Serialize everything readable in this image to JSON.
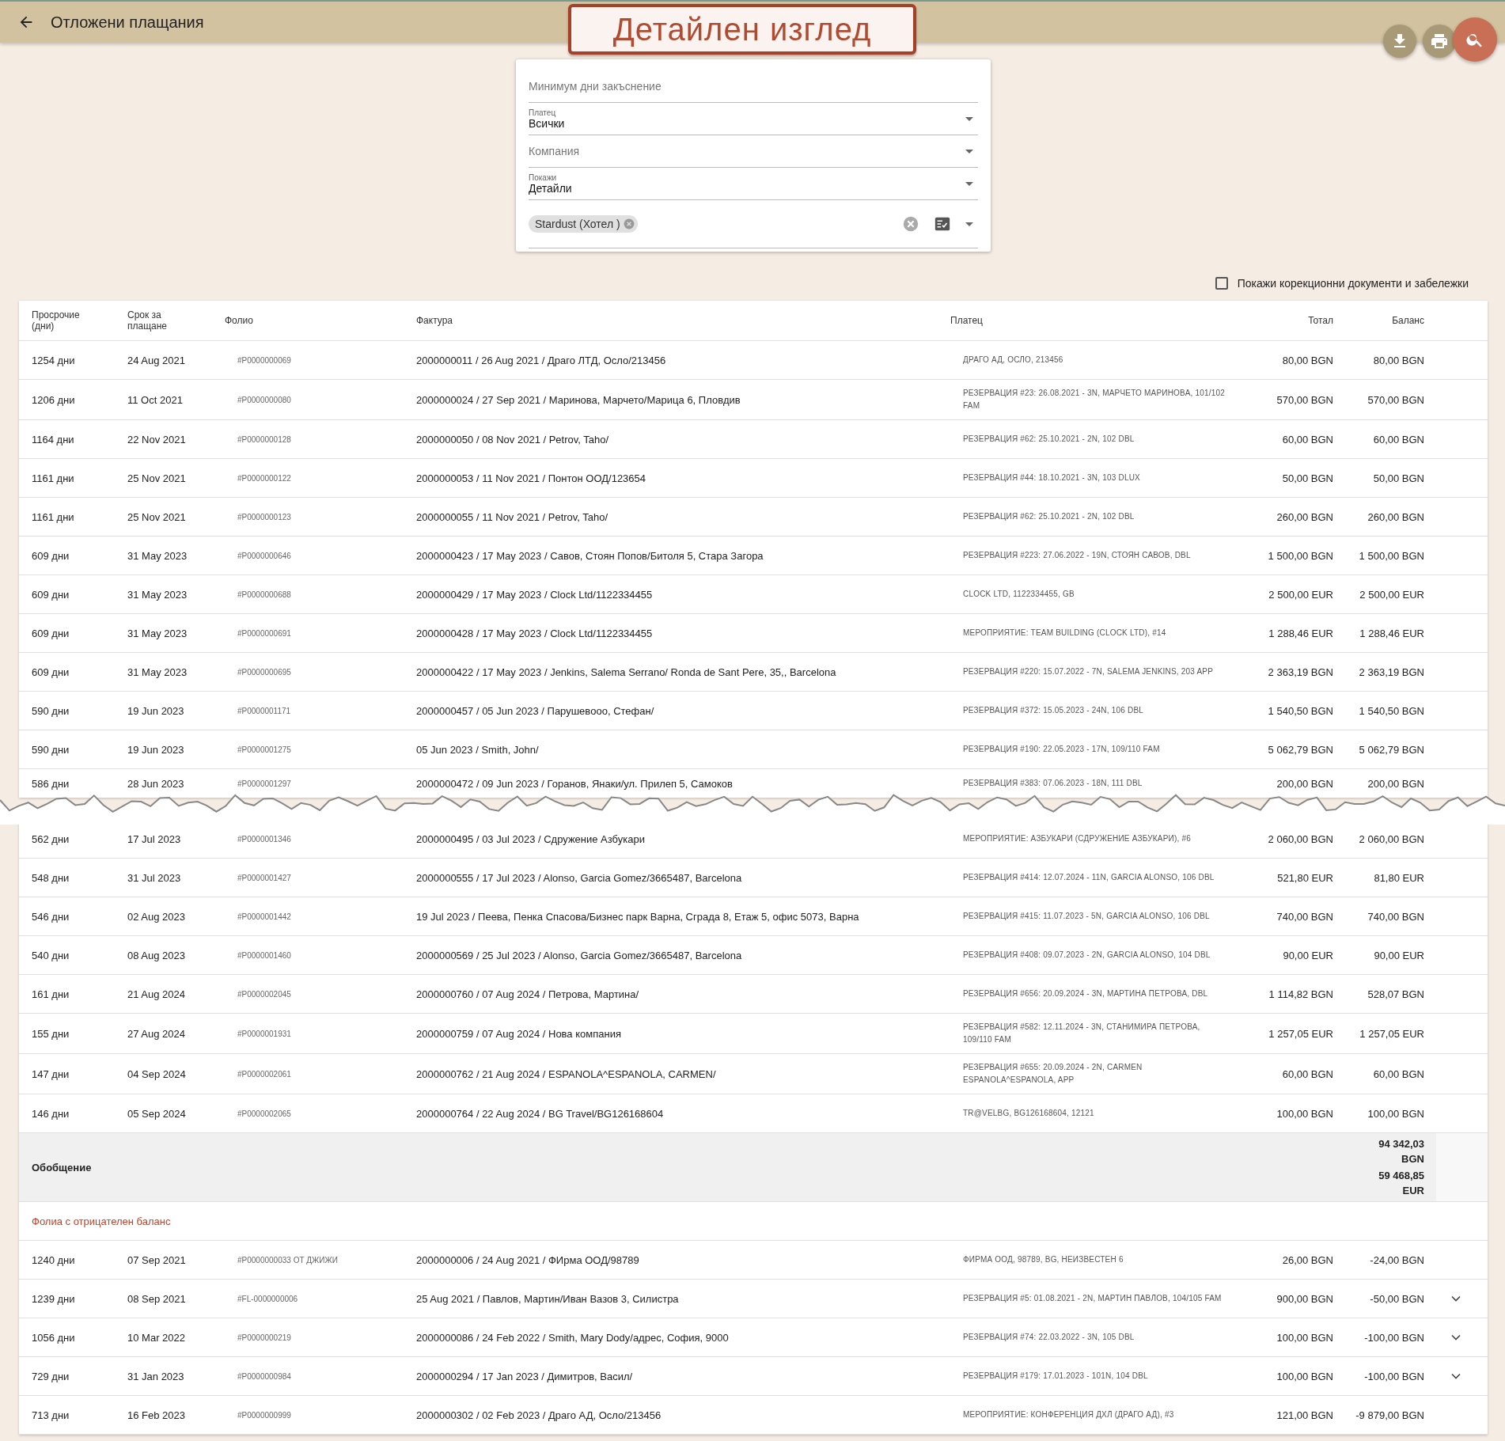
{
  "header": {
    "title": "Отложени плащания"
  },
  "banner": {
    "text": "Детайлен изглед"
  },
  "filters": {
    "min_days": {
      "placeholder": "Минимум дни закъснение"
    },
    "payer": {
      "label": "Платец",
      "value": "Всички"
    },
    "company": {
      "placeholder": "Компания"
    },
    "show": {
      "label": "Покажи",
      "value": "Детайли"
    },
    "chips": [
      "Stardust (Хотел )"
    ]
  },
  "corrections": {
    "label": "Покажи корекционни документи и забележки",
    "checked": false
  },
  "table": {
    "columns": [
      "Просрочие (дни)",
      "Срок за плащане",
      "Фолио",
      "Фактура",
      "Платец",
      "Тотал",
      "Баланс"
    ],
    "rows_top": [
      {
        "overdue": "1254 дни",
        "due": "24 Aug 2021",
        "folio": "#P0000000069",
        "invoice": "2000000011 / 26 Aug 2021 / Драго ЛТД, Осло/213456",
        "payer": "ДРАГО АД, ОСЛО, 213456",
        "total": "80,00 BGN",
        "balance": "80,00 BGN"
      },
      {
        "overdue": "1206 дни",
        "due": "11 Oct 2021",
        "folio": "#P0000000080",
        "invoice": "2000000024 / 27 Sep 2021 / Маринова, Марчето/Марица 6, Пловдив",
        "payer": "РЕЗЕРВАЦИЯ #23: 26.08.2021 - 3N, МАРЧЕТО МАРИНОВА, 101/102 FAM",
        "total": "570,00 BGN",
        "balance": "570,00 BGN"
      },
      {
        "overdue": "1164 дни",
        "due": "22 Nov 2021",
        "folio": "#P0000000128",
        "invoice": "2000000050 / 08 Nov 2021 / Petrov, Taho/",
        "payer": "РЕЗЕРВАЦИЯ #62: 25.10.2021 - 2N, 102 DBL",
        "total": "60,00 BGN",
        "balance": "60,00 BGN"
      },
      {
        "overdue": "1161 дни",
        "due": "25 Nov 2021",
        "folio": "#P0000000122",
        "invoice": "2000000053 / 11 Nov 2021 / Понтон ООД/123654",
        "payer": "РЕЗЕРВАЦИЯ #44: 18.10.2021 - 3N, 103 DLUX",
        "total": "50,00 BGN",
        "balance": "50,00 BGN"
      },
      {
        "overdue": "1161 дни",
        "due": "25 Nov 2021",
        "folio": "#P0000000123",
        "invoice": "2000000055 / 11 Nov 2021 / Petrov, Taho/",
        "payer": "РЕЗЕРВАЦИЯ #62: 25.10.2021 - 2N, 102 DBL",
        "total": "260,00 BGN",
        "balance": "260,00 BGN"
      },
      {
        "overdue": "609 дни",
        "due": "31 May 2023",
        "folio": "#P0000000646",
        "invoice": "2000000423 / 17 May 2023 / Савов, Стоян Попов/Битоля 5, Стара Загора",
        "payer": "РЕЗЕРВАЦИЯ #223: 27.06.2022 - 19N, СТОЯН САВОВ, DBL",
        "total": "1 500,00 BGN",
        "balance": "1 500,00 BGN"
      },
      {
        "overdue": "609 дни",
        "due": "31 May 2023",
        "folio": "#P0000000688",
        "invoice": "2000000429 / 17 May 2023 / Clock Ltd/1122334455",
        "payer": "CLOCK LTD, 1122334455, GB",
        "total": "2 500,00 EUR",
        "balance": "2 500,00 EUR"
      },
      {
        "overdue": "609 дни",
        "due": "31 May 2023",
        "folio": "#P0000000691",
        "invoice": "2000000428 / 17 May 2023 / Clock Ltd/1122334455",
        "payer": "МЕРОПРИЯТИЕ: TEAM BUILDING (CLOCK LTD), #14",
        "total": "1 288,46 EUR",
        "balance": "1 288,46 EUR"
      },
      {
        "overdue": "609 дни",
        "due": "31 May 2023",
        "folio": "#P0000000695",
        "invoice": "2000000422 / 17 May 2023 / Jenkins, Salema Serrano/ Ronda de Sant Pere, 35,, Barcelona",
        "payer": "РЕЗЕРВАЦИЯ #220: 15.07.2022 - 7N, SALEMA JENKINS, 203 APP",
        "total": "2 363,19 BGN",
        "balance": "2 363,19 BGN"
      },
      {
        "overdue": "590 дни",
        "due": "19 Jun 2023",
        "folio": "#P0000001171",
        "invoice": "2000000457 / 05 Jun 2023 / Парушевooo, Стефан/",
        "payer": "РЕЗЕРВАЦИЯ #372: 15.05.2023 - 24N, 106 DBL",
        "total": "1 540,50 BGN",
        "balance": "1 540,50 BGN"
      },
      {
        "overdue": "590 дни",
        "due": "19 Jun 2023",
        "folio": "#P0000001275",
        "invoice": "05 Jun 2023 / Smith, John/",
        "payer": "РЕЗЕРВАЦИЯ #190: 22.05.2023 - 17N, 109/110 FAM",
        "total": "5 062,79 BGN",
        "balance": "5 062,79 BGN"
      },
      {
        "overdue": "586 дни",
        "due": "28 Jun 2023",
        "folio": "#P0000001297",
        "invoice": "2000000472 / 09 Jun 2023 / Горанов, Янаки/ул. Прилеп 5, Самоков",
        "payer": "РЕЗЕРВАЦИЯ #383: 07.06.2023 - 18N, 111 DBL",
        "total": "200,00 BGN",
        "balance": "200,00 BGN"
      }
    ],
    "rows_bottom": [
      {
        "overdue": "562 дни",
        "due": "17 Jul 2023",
        "folio": "#P0000001346",
        "invoice": "2000000495 / 03 Jul 2023 / Сдружение Азбукари",
        "payer": "МЕРОПРИЯТИЕ: АЗБУКАРИ (СДРУЖЕНИЕ АЗБУКАРИ), #6",
        "total": "2 060,00 BGN",
        "balance": "2 060,00 BGN"
      },
      {
        "overdue": "548 дни",
        "due": "31 Jul 2023",
        "folio": "#P0000001427",
        "invoice": "2000000555 / 17 Jul 2023 / Alonso, Garcia Gomez/3665487, Barcelona",
        "payer": "РЕЗЕРВАЦИЯ #414: 12.07.2024 - 11N, GARCIA ALONSO, 106 DBL",
        "total": "521,80 EUR",
        "balance": "81,80 EUR"
      },
      {
        "overdue": "546 дни",
        "due": "02 Aug 2023",
        "folio": "#P0000001442",
        "invoice": "19 Jul 2023 / Пеева, Пенка Спасова/Бизнес парк Варна, Сграда 8, Етаж 5, офис 5073, Варна",
        "payer": "РЕЗЕРВАЦИЯ #415: 11.07.2023 - 5N, GARCIA ALONSO, 106 DBL",
        "total": "740,00 BGN",
        "balance": "740,00 BGN"
      },
      {
        "overdue": "540 дни",
        "due": "08 Aug 2023",
        "folio": "#P0000001460",
        "invoice": "2000000569 / 25 Jul 2023 / Alonso, Garcia Gomez/3665487, Barcelona",
        "payer": "РЕЗЕРВАЦИЯ #408: 09.07.2023 - 2N, GARCIA ALONSO, 104 DBL",
        "total": "90,00 EUR",
        "balance": "90,00 EUR"
      },
      {
        "overdue": "161 дни",
        "due": "21 Aug 2024",
        "folio": "#P0000002045",
        "invoice": "2000000760 / 07 Aug 2024 / Петрова, Мартина/",
        "payer": "РЕЗЕРВАЦИЯ #656: 20.09.2024 - 3N, МАРТИНА ПЕТРОВА, DBL",
        "total": "1 114,82 BGN",
        "balance": "528,07 BGN"
      },
      {
        "overdue": "155 дни",
        "due": "27 Aug 2024",
        "folio": "#P0000001931",
        "invoice": "2000000759 / 07 Aug 2024 / Нова компания",
        "payer": "РЕЗЕРВАЦИЯ #582: 12.11.2024 - 3N, СТАНИМИРА ПЕТРОВА, 109/110 FAM",
        "total": "1 257,05 EUR",
        "balance": "1 257,05 EUR"
      },
      {
        "overdue": "147 дни",
        "due": "04 Sep 2024",
        "folio": "#P0000002061",
        "invoice": "2000000762 / 21 Aug 2024 / ESPANOLA^ESPANOLA, CARMEN/",
        "payer": "РЕЗЕРВАЦИЯ #655: 20.09.2024 - 2N, CARMEN ESPANOLA^ESPANOLA, APP",
        "total": "60,00 BGN",
        "balance": "60,00 BGN"
      },
      {
        "overdue": "146 дни",
        "due": "05 Sep 2024",
        "folio": "#P0000002065",
        "invoice": "2000000764 / 22 Aug 2024 / BG Travel/BG126168604",
        "payer": "TR@VELBG, BG126168604, 12121",
        "total": "100,00 BGN",
        "balance": "100,00 BGN"
      }
    ],
    "summary": {
      "label": "Обобщение",
      "totals": [
        "94 342,03 BGN",
        "59 468,85 EUR"
      ]
    },
    "negative": {
      "title": "Фолиа с отрицателен баланс",
      "rows": [
        {
          "overdue": "1240 дни",
          "due": "07 Sep 2021",
          "folio": "#P0000000033 ОТ ДЖИЖИ",
          "invoice": "2000000006 / 24 Aug 2021 / ФИрма ООД/98789",
          "payer": "ФИРМА ООД, 98789, BG, НЕИЗВЕСТЕН 6",
          "total": "26,00 BGN",
          "balance": "-24,00 BGN",
          "expandable": false
        },
        {
          "overdue": "1239 дни",
          "due": "08 Sep 2021",
          "folio": "#FL-0000000006",
          "invoice": "25 Aug 2021 / Павлов, Мартин/Иван Вазов 3, Силистра",
          "payer": "РЕЗЕРВАЦИЯ #5: 01.08.2021 - 2N, МАРТИН ПАВЛОВ, 104/105 FAM",
          "total": "900,00 BGN",
          "balance": "-50,00 BGN",
          "expandable": true
        },
        {
          "overdue": "1056 дни",
          "due": "10 Mar 2022",
          "folio": "#P0000000219",
          "invoice": "2000000086 / 24 Feb 2022 / Smith, Mary Dody/адрес, София, 9000",
          "payer": "РЕЗЕРВАЦИЯ #74: 22.03.2022 - 3N, 105 DBL",
          "total": "100,00 BGN",
          "balance": "-100,00 BGN",
          "expandable": true
        },
        {
          "overdue": "729 дни",
          "due": "31 Jan 2023",
          "folio": "#P0000000984",
          "invoice": "2000000294 / 17 Jan 2023 / Димитров, Васил/",
          "payer": "РЕЗЕРВАЦИЯ #179: 17.01.2023 - 101N, 104 DBL",
          "total": "100,00 BGN",
          "balance": "-100,00 BGN",
          "expandable": true
        },
        {
          "overdue": "713 дни",
          "due": "16 Feb 2023",
          "folio": "#P0000000999",
          "invoice": "2000000302 / 02 Feb 2023 / Драго АД, Осло/213456",
          "payer": "МЕРОПРИЯТИЕ: КОНФЕРЕНЦИЯ ДХЛ (ДРАГО АД), #3",
          "total": "121,00 BGN",
          "balance": "-9 879,00 BGN",
          "expandable": false
        }
      ]
    }
  }
}
